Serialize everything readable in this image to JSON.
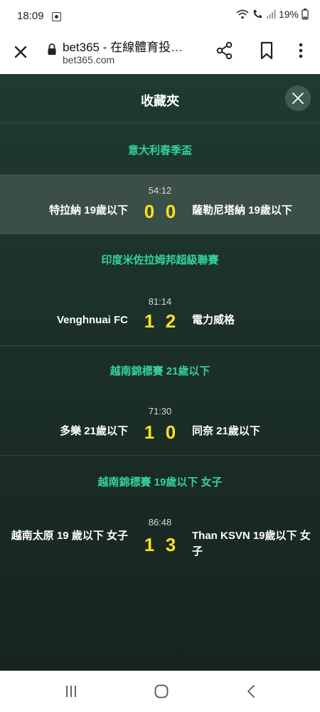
{
  "status": {
    "time": "18:09",
    "battery": "19%"
  },
  "browser": {
    "title": "bet365 - 在線體育投…",
    "url": "bet365.com"
  },
  "panel": {
    "title": "收藏夾"
  },
  "colors": {
    "accent": "#34d39a",
    "score": "#ffdf1b",
    "panel_bg": "#1c3129"
  },
  "leagues": [
    {
      "name": "意大利春季盃",
      "match": {
        "time": "54:12",
        "home": "特拉納 19歲以下",
        "away": "薩勒尼塔納 19歲以下",
        "home_score": "0",
        "away_score": "0"
      }
    },
    {
      "name": "印度米佐拉姆邦超級聯賽",
      "match": {
        "time": "81:14",
        "home": "Venghnuai FC",
        "away": "電力威格",
        "home_score": "1",
        "away_score": "2"
      }
    },
    {
      "name": "越南錦標賽 21歲以下",
      "match": {
        "time": "71:30",
        "home": "多樂 21歲以下",
        "away": "同奈 21歲以下",
        "home_score": "1",
        "away_score": "0"
      }
    },
    {
      "name": "越南錦標賽 19歲以下 女子",
      "match": {
        "time": "86:48",
        "home": "越南太原 19 歲以下 女子",
        "away": "Than KSVN 19歲以下 女子",
        "home_score": "1",
        "away_score": "3"
      }
    }
  ],
  "icons": [
    "close-icon",
    "lock-icon",
    "share-icon",
    "bookmark-icon",
    "more-icon",
    "recent-apps-icon",
    "home-icon",
    "back-icon"
  ]
}
